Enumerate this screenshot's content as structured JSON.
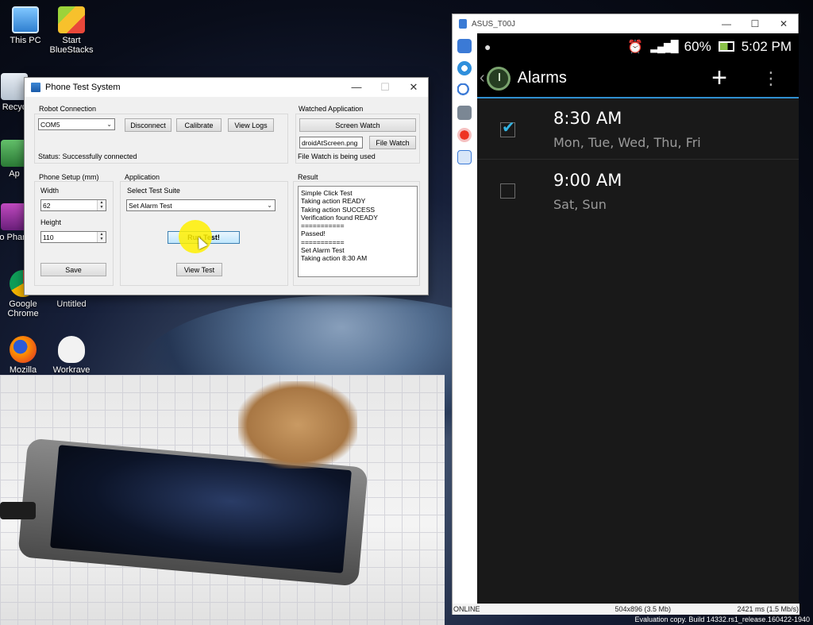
{
  "desktop": {
    "icons": [
      {
        "label": "This PC",
        "icon": "computer-icon"
      },
      {
        "label": "Start BlueStacks",
        "icon": "bluestacks-icon"
      },
      {
        "label": "Recyc",
        "icon": "recycle-bin-icon"
      },
      {
        "label": "Ap",
        "icon": "app-icon"
      },
      {
        "label": "Fo Phanto",
        "icon": "phantom-icon"
      },
      {
        "label": "Google Chrome",
        "icon": "chrome-icon"
      },
      {
        "label": "Untitled",
        "icon": "document-icon"
      },
      {
        "label": "Mozilla",
        "icon": "firefox-icon"
      },
      {
        "label": "Workrave",
        "icon": "workrave-sheep-icon"
      }
    ]
  },
  "app": {
    "title": "Phone Test System",
    "robot": {
      "group_label": "Robot Connection",
      "port_value": "COM5",
      "disconnect": "Disconnect",
      "calibrate": "Calibrate",
      "view_logs": "View Logs",
      "status": "Status: Successfully connected"
    },
    "watched": {
      "group_label": "Watched Application",
      "screen_watch": "Screen Watch",
      "file_value": "droidAtScreen.png",
      "file_watch": "File Watch",
      "note": "File Watch is being used"
    },
    "phone_setup": {
      "group_label": "Phone Setup (mm)",
      "width_label": "Width",
      "width_value": "62",
      "height_label": "Height",
      "height_value": "110",
      "save": "Save"
    },
    "application": {
      "group_label": "Application",
      "suite_label": "Select Test Suite",
      "suite_value": "Set Alarm Test",
      "run": "Run Test!",
      "view_test": "View Test"
    },
    "result": {
      "group_label": "Result",
      "lines": [
        "Simple Click Test",
        "Taking action READY",
        "Taking action SUCCESS",
        "Verification found READY",
        "===========",
        "Passed!",
        "===========",
        "Set Alarm Test",
        "Taking action 8:30 AM"
      ]
    }
  },
  "emulator": {
    "title": "ASUS_T00J",
    "statusbar": {
      "battery": "60%",
      "time": "5:02 PM"
    },
    "screen_title": "Alarms",
    "alarms": [
      {
        "time": "8:30 AM",
        "days": "Mon, Tue, Wed, Thu, Fri",
        "enabled": true
      },
      {
        "time": "9:00 AM",
        "days": "Sat, Sun",
        "enabled": false
      }
    ],
    "footer": {
      "state": "ONLINE",
      "resolution": "504x896 (3.5 Mb)",
      "timing": "2421 ms (1.5 Mb/s)"
    }
  },
  "evaluation_text": "Evaluation copy. Build 14332.rs1_release.160422-1940"
}
